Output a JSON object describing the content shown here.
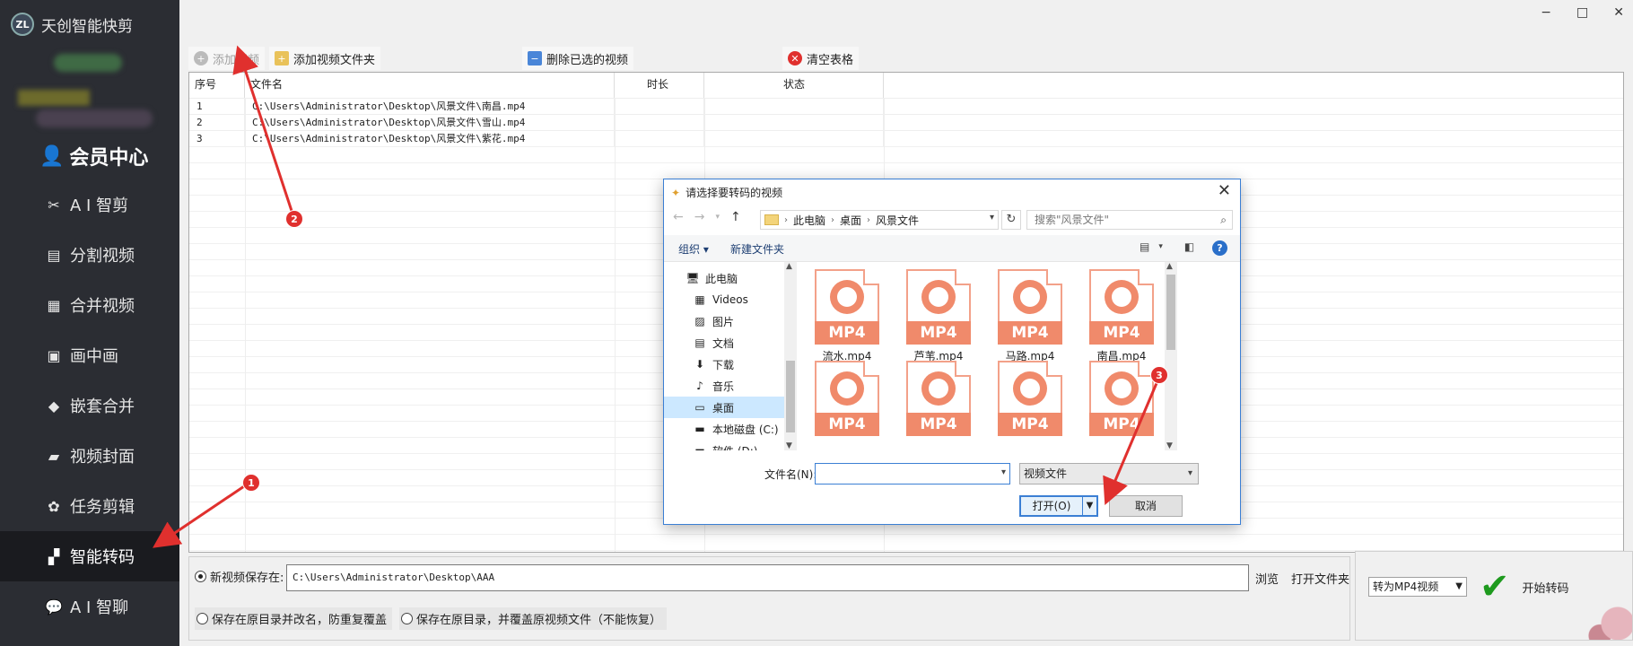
{
  "app": {
    "title": "天创智能快剪",
    "logo_text": "ZL",
    "member_label": "会员中心"
  },
  "window_controls": {
    "minimize": "−",
    "maximize": "□",
    "close": "✕"
  },
  "sidebar": {
    "items": [
      {
        "label": "A I 智剪",
        "icon": "ai-cut-icon",
        "glyph": "✂"
      },
      {
        "label": "分割视频",
        "icon": "split-video-icon",
        "glyph": "▤"
      },
      {
        "label": "合并视频",
        "icon": "merge-video-icon",
        "glyph": "▦"
      },
      {
        "label": "画中画",
        "icon": "picture-in-picture-icon",
        "glyph": "▣"
      },
      {
        "label": "嵌套合并",
        "icon": "nested-merge-icon",
        "glyph": "◆"
      },
      {
        "label": "视频封面",
        "icon": "video-cover-icon",
        "glyph": "▰"
      },
      {
        "label": "任务剪辑",
        "icon": "task-edit-icon",
        "glyph": "✿"
      },
      {
        "label": "智能转码",
        "icon": "smart-transcode-icon",
        "glyph": "▞",
        "active": true
      },
      {
        "label": "A I 智聊",
        "icon": "ai-chat-icon",
        "glyph": "💬"
      }
    ]
  },
  "toolbar": {
    "add_video": "添加视频",
    "add_folder": "添加视频文件夹",
    "delete_selected": "删除已选的视频",
    "clear_table": "清空表格"
  },
  "table": {
    "headers": {
      "index": "序号",
      "filename": "文件名",
      "duration": "时长",
      "status": "状态"
    },
    "rows": [
      {
        "index": "1",
        "filename": "C:\\Users\\Administrator\\Desktop\\风景文件\\南昌.mp4",
        "duration": "",
        "status": ""
      },
      {
        "index": "2",
        "filename": "C:\\Users\\Administrator\\Desktop\\风景文件\\雪山.mp4",
        "duration": "",
        "status": ""
      },
      {
        "index": "3",
        "filename": "C:\\Users\\Administrator\\Desktop\\风景文件\\紫花.mp4",
        "duration": "",
        "status": ""
      }
    ]
  },
  "bottom": {
    "save_label": "新视频保存在:",
    "save_path": "C:\\Users\\Administrator\\Desktop\\AAA",
    "browse": "浏览",
    "open_folder": "打开文件夹",
    "option_rename": "保存在原目录并改名，防重复覆盖",
    "option_overwrite": "保存在原目录，并覆盖原视频文件（不能恢复）",
    "format_select": "转为MP4视频",
    "start_button": "开始转码"
  },
  "dialog": {
    "title": "请选择要转码的视频",
    "breadcrumb": [
      "此电脑",
      "桌面",
      "风景文件"
    ],
    "search_placeholder": "搜索\"风景文件\"",
    "organize": "组织 ▾",
    "new_folder": "新建文件夹",
    "help": "?",
    "tree": [
      {
        "label": "此电脑",
        "glyph": "🖥",
        "icon": "this-pc-icon",
        "level": 0
      },
      {
        "label": "Videos",
        "glyph": "▦",
        "icon": "videos-folder-icon",
        "level": 1
      },
      {
        "label": "图片",
        "glyph": "▨",
        "icon": "pictures-folder-icon",
        "level": 1
      },
      {
        "label": "文档",
        "glyph": "▤",
        "icon": "documents-folder-icon",
        "level": 1
      },
      {
        "label": "下载",
        "glyph": "⬇",
        "icon": "downloads-folder-icon",
        "level": 1
      },
      {
        "label": "音乐",
        "glyph": "♪",
        "icon": "music-folder-icon",
        "level": 1
      },
      {
        "label": "桌面",
        "glyph": "▭",
        "icon": "desktop-folder-icon",
        "level": 1,
        "selected": true
      },
      {
        "label": "本地磁盘 (C:)",
        "glyph": "▬",
        "icon": "local-disk-icon",
        "level": 1
      },
      {
        "label": "软件 (D:)",
        "glyph": "▬",
        "icon": "disk-d-icon",
        "level": 1
      }
    ],
    "files": [
      {
        "name": "流水.mp4",
        "badge": "MP4"
      },
      {
        "name": "芦苇.mp4",
        "badge": "MP4"
      },
      {
        "name": "马路.mp4",
        "badge": "MP4"
      },
      {
        "name": "南昌.mp4",
        "badge": "MP4"
      },
      {
        "name": "",
        "badge": "MP4"
      },
      {
        "name": "",
        "badge": "MP4"
      },
      {
        "name": "",
        "badge": "MP4"
      },
      {
        "name": "",
        "badge": "MP4"
      }
    ],
    "filename_label": "文件名(N):",
    "filename_value": "",
    "filetype": "视频文件",
    "open": "打开(O)",
    "cancel": "取消"
  },
  "annotations": [
    "1",
    "2",
    "3"
  ],
  "colors": {
    "sidebar_bg": "#2b2d33",
    "accent_red": "#e0302e",
    "file_orange": "#f08a6b",
    "dialog_border": "#3b7fd4"
  }
}
